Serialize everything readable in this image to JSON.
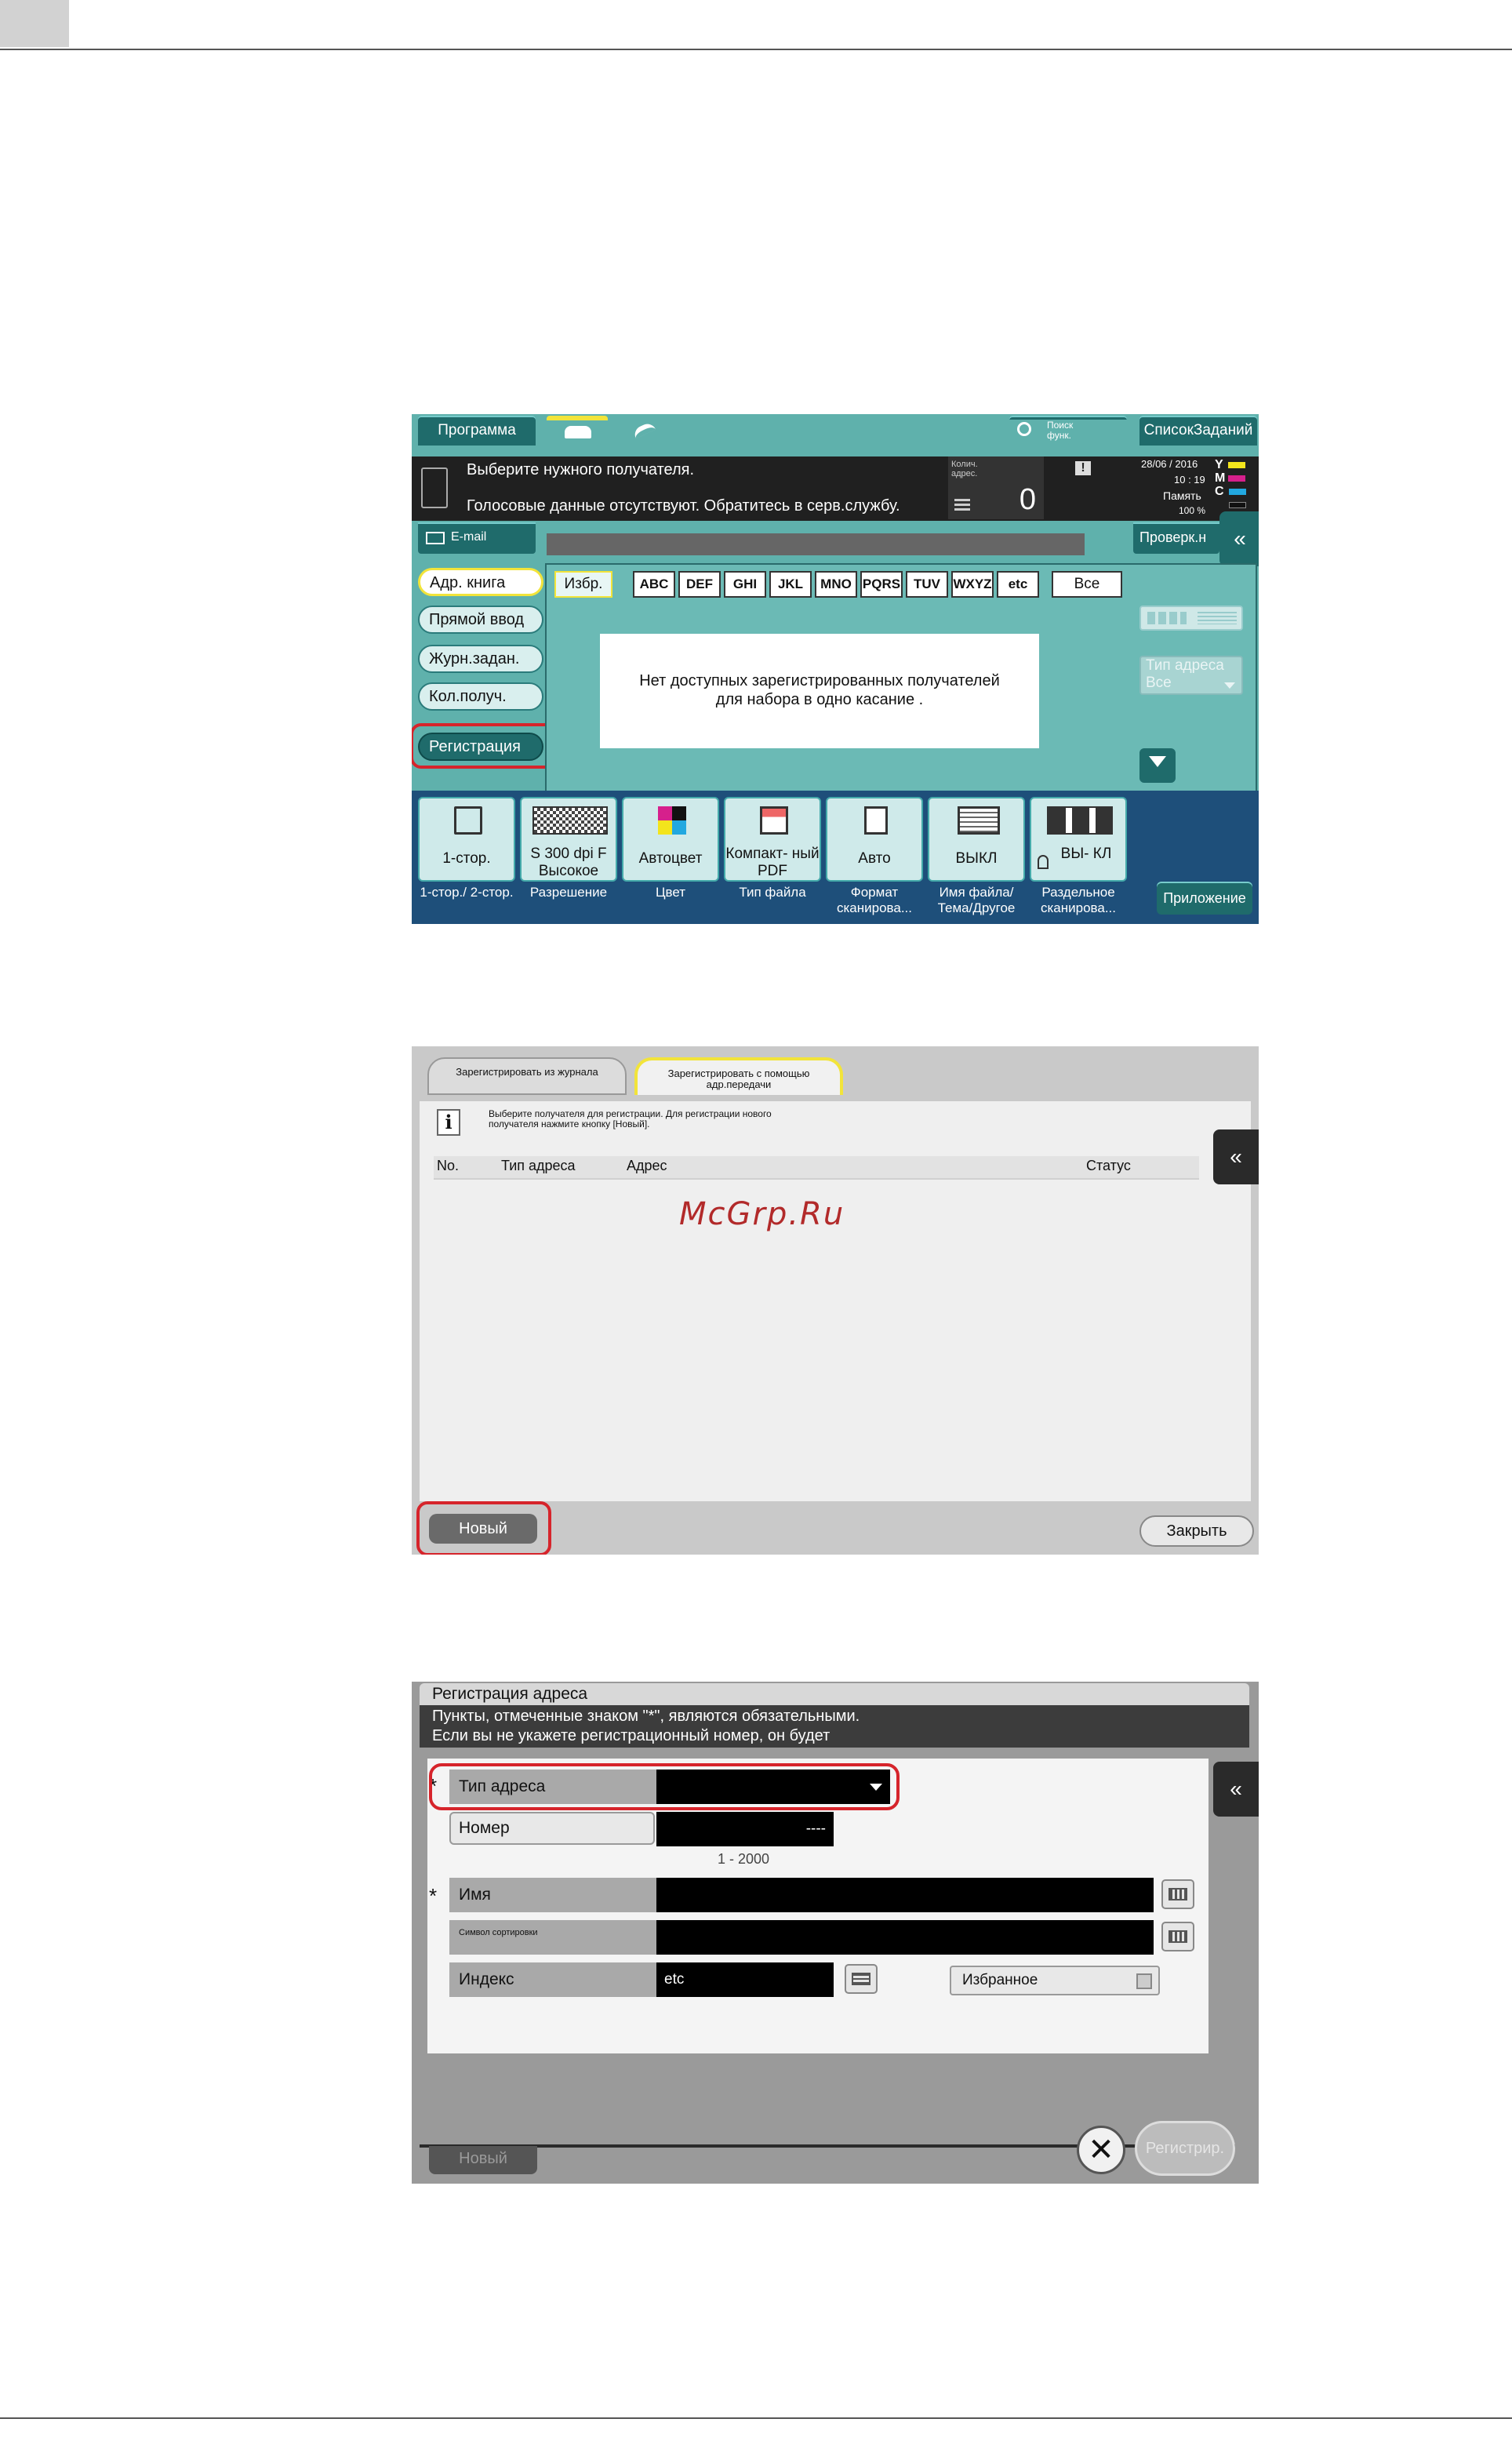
{
  "screen1": {
    "program_label": "Программа",
    "search_label": "Поиск функ.",
    "job_list_label": "СписокЗаданий",
    "message_line1": "Выберите нужного получателя.",
    "message_line2": "Голосовые данные отсутствуют. Обратитесь в серв.службу.",
    "recipient_count_caption": "Колич. адрес.",
    "recipient_count": "0",
    "date": "28/06 / 2016",
    "time": "10 : 19",
    "memory_label": "Память",
    "memory_value": "100 %",
    "toner": [
      "Y",
      "M",
      "C",
      "K"
    ],
    "email_label": "E-mail",
    "check_label": "Проверк.н",
    "side_tabs": [
      "Адр. книга",
      "Прямой ввод",
      "Журн.задан.",
      "Кол.получ.",
      "Регистрация"
    ],
    "alpha_tabs": [
      "Избр.",
      "ABC",
      "DEF",
      "GHI",
      "JKL",
      "MNO",
      "PQRS",
      "TUV",
      "WXYZ",
      "etc",
      "Все"
    ],
    "no_recipients_line1": "Нет доступных зарегистрированных получателей",
    "no_recipients_line2": "для набора в одно касание .",
    "address_type_label": "Тип адреса",
    "address_type_value": "Все",
    "functions": [
      {
        "value": "1-стор.",
        "label": "1-стор./ 2-стор."
      },
      {
        "value": "S 300 dpi F Высокое",
        "label": "Разрешение"
      },
      {
        "value": "Автоцвет",
        "label": "Цвет"
      },
      {
        "value": "Компакт- ный PDF",
        "label": "Тип файла"
      },
      {
        "value": "Авто",
        "label": "Формат сканирова..."
      },
      {
        "value": "ВЫКЛ",
        "label": "Имя файла/ Тема/Другое"
      },
      {
        "value": "ВЫ- КЛ",
        "label": "Раздельное сканирова..."
      }
    ],
    "app_label": "Приложение",
    "colors": {
      "teal": "#5fb1ac",
      "dark_teal": "#1f6b6b",
      "highlight": "#d6242b"
    }
  },
  "screen2": {
    "tab_journal": "Зарегистрировать из журнала",
    "tab_transmission": "Зарегистрировать с помощью адр.передачи",
    "info_text": "Выберите получателя для регистрации. Для регистрации нового получателя нажмите кнопку [Новый].",
    "columns": [
      "No.",
      "Тип адреса",
      "Адрес",
      "Статус"
    ],
    "new_button": "Новый",
    "close_button": "Закрыть"
  },
  "screen3": {
    "title": "Регистрация адреса",
    "note_line1": "Пункты, отмеченные знаком \"*\", являются обязательными.",
    "note_line2": "Если вы не укажете регистрационный номер, он будет",
    "fields": {
      "address_type": "Тип адреса",
      "number": "Номер",
      "number_value": "----",
      "number_range": "1 - 2000",
      "name": "Имя",
      "sort_symbol": "Символ сортировки",
      "index": "Индекс",
      "index_value": "etc",
      "favorite": "Избранное"
    },
    "required_mark": "*",
    "new_button": "Новый",
    "register_button": "Регистрир."
  },
  "watermark": "McGrp.Ru"
}
